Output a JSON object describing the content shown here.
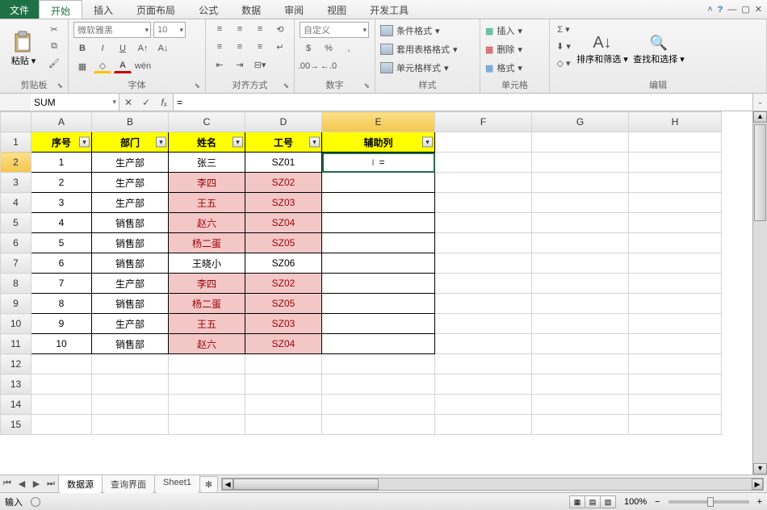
{
  "menu": {
    "file": "文件",
    "tabs": [
      "开始",
      "插入",
      "页面布局",
      "公式",
      "数据",
      "审阅",
      "视图",
      "开发工具"
    ],
    "active_tab": 0
  },
  "ribbon": {
    "clipboard": {
      "label": "剪贴板",
      "paste": "粘贴"
    },
    "font": {
      "label": "字体",
      "name": "微软雅黑",
      "size": "10"
    },
    "align": {
      "label": "对齐方式"
    },
    "number": {
      "label": "数字",
      "format": "自定义"
    },
    "styles": {
      "label": "样式",
      "cond": "条件格式",
      "table": "套用表格格式",
      "cell": "单元格样式"
    },
    "cells": {
      "label": "单元格",
      "insert": "插入",
      "delete": "删除",
      "format": "格式"
    },
    "editing": {
      "label": "编辑",
      "sort": "排序和筛选",
      "find": "查找和选择"
    }
  },
  "formula_bar": {
    "name_box": "SUM",
    "value": "="
  },
  "columns": [
    "A",
    "B",
    "C",
    "D",
    "E",
    "F",
    "G",
    "H"
  ],
  "headers": [
    "序号",
    "部门",
    "姓名",
    "工号",
    "辅助列"
  ],
  "rows": [
    {
      "n": "1",
      "dept": "生产部",
      "name": "张三",
      "id": "SZ01",
      "pink": false
    },
    {
      "n": "2",
      "dept": "生产部",
      "name": "李四",
      "id": "SZ02",
      "pink": true
    },
    {
      "n": "3",
      "dept": "生产部",
      "name": "王五",
      "id": "SZ03",
      "pink": true
    },
    {
      "n": "4",
      "dept": "销售部",
      "name": "赵六",
      "id": "SZ04",
      "pink": true
    },
    {
      "n": "5",
      "dept": "销售部",
      "name": "杨二蛋",
      "id": "SZ05",
      "pink": true
    },
    {
      "n": "6",
      "dept": "销售部",
      "name": "王晓小",
      "id": "SZ06",
      "pink": false
    },
    {
      "n": "7",
      "dept": "生产部",
      "name": "李四",
      "id": "SZ02",
      "pink": true
    },
    {
      "n": "8",
      "dept": "销售部",
      "name": "杨二蛋",
      "id": "SZ05",
      "pink": true
    },
    {
      "n": "9",
      "dept": "生产部",
      "name": "王五",
      "id": "SZ03",
      "pink": true
    },
    {
      "n": "10",
      "dept": "销售部",
      "name": "赵六",
      "id": "SZ04",
      "pink": true
    }
  ],
  "active_cell": {
    "row": 2,
    "col": "E",
    "display": "="
  },
  "sheet_tabs": [
    "数据源",
    "查询界面",
    "Sheet1"
  ],
  "active_sheet": 0,
  "status": {
    "mode": "输入",
    "zoom": "100%"
  }
}
